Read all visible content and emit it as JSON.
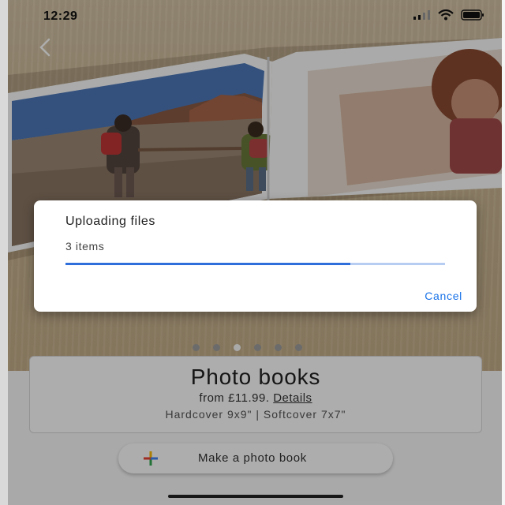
{
  "status_bar": {
    "time": "12:29",
    "icons": [
      "cellular-signal-icon",
      "wifi-icon",
      "battery-icon"
    ]
  },
  "hero": {
    "back_icon": "chevron-left-icon",
    "carousel": {
      "count": 6,
      "active_index": 2
    }
  },
  "product": {
    "title": "Photo books",
    "price_text": "from £11.99.",
    "details_link": "Details",
    "sizes": "Hardcover 9x9\" | Softcover 7x7\""
  },
  "make_button": {
    "label": "Make a photo book",
    "icon": "multicolor-plus-icon"
  },
  "upload_dialog": {
    "title": "Uploading files",
    "count_text": "3 items",
    "progress_fraction": 0.75,
    "cancel_label": "Cancel"
  },
  "colors": {
    "accent": "#1a73e8",
    "progress_fill": "#2f6fdc",
    "progress_track": "#b7cdf2",
    "plus_blue": "#4285f4",
    "plus_red": "#ea4335",
    "plus_yellow": "#fbbc05",
    "plus_green": "#34a853"
  }
}
